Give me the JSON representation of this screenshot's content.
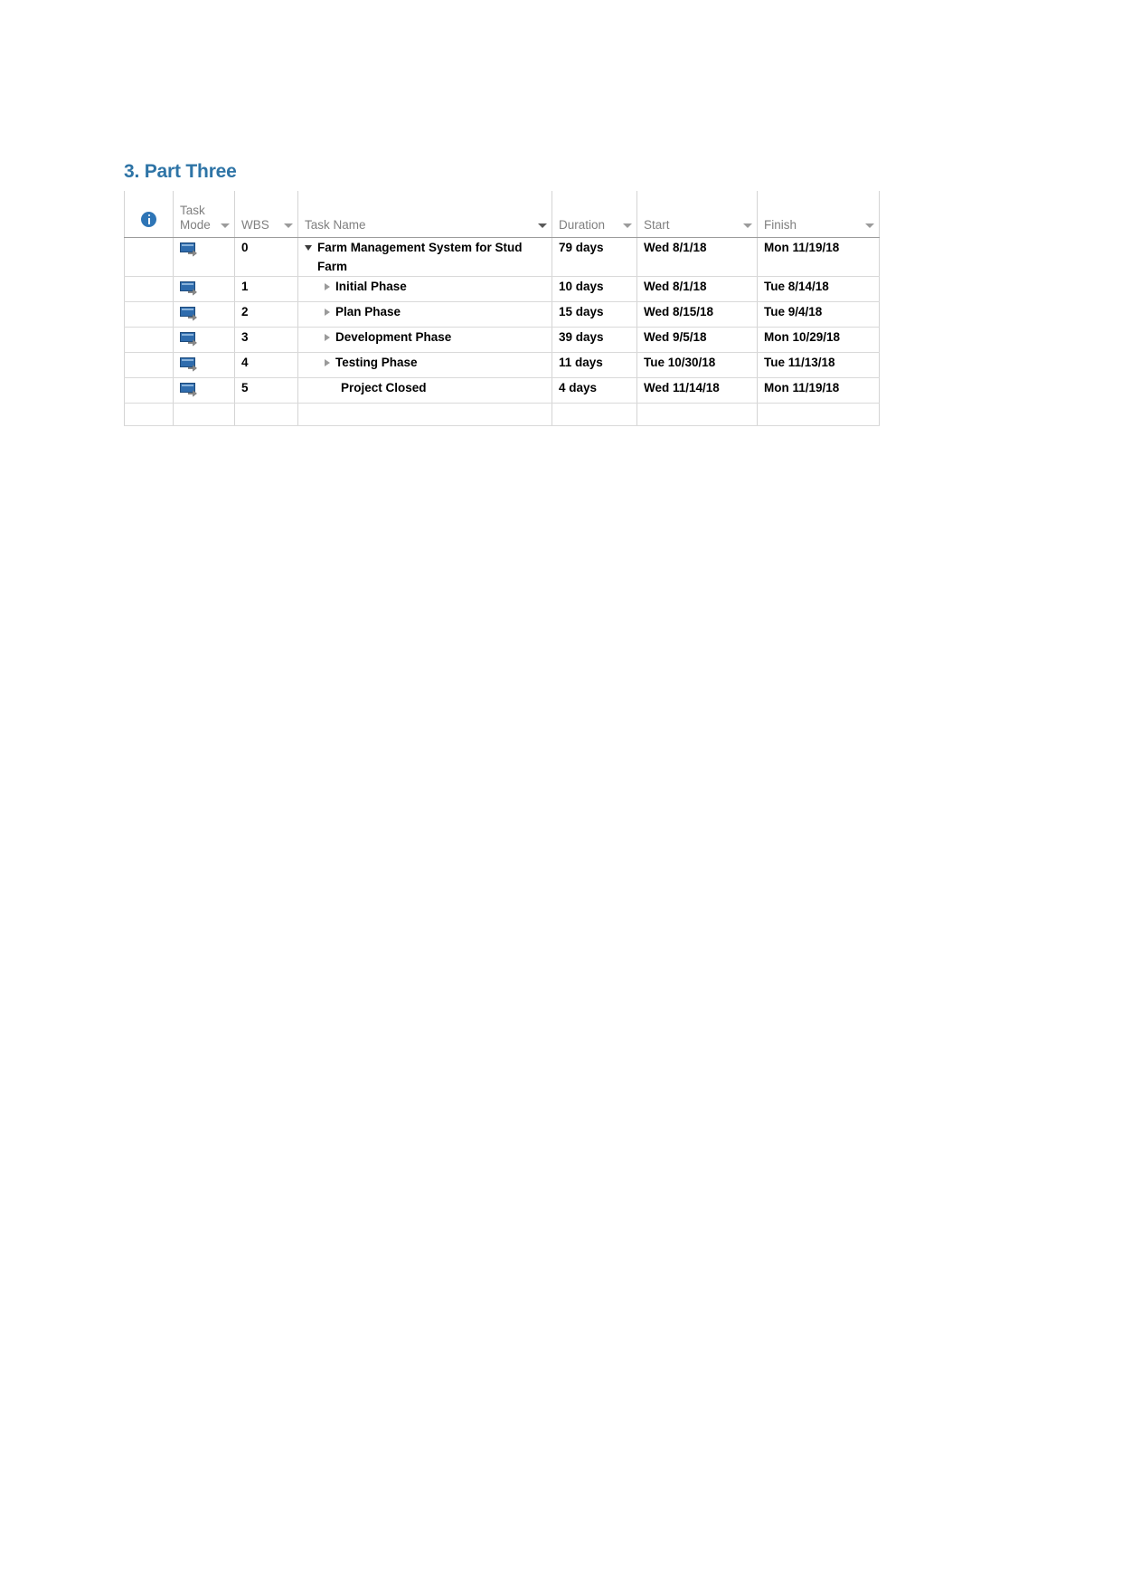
{
  "page": {
    "heading": "3. Part Three"
  },
  "table": {
    "headers": {
      "info": "information-column",
      "task_mode": "Task\nMode",
      "wbs": "WBS",
      "task_name": "Task Name",
      "duration": "Duration",
      "start": "Start",
      "finish": "Finish"
    },
    "selected_column": "Task Name",
    "accent_colors": {
      "heading_blue": "#2E74A6",
      "selected_header_text": "#507E32",
      "selected_header_underline": "#4A7C2F",
      "selected_header_fill": "#DEDEDE",
      "task_mode_icon_blue": "#2F6CAD",
      "info_icon_blue": "#2E75B6",
      "header_text_gray": "#7F7F7F"
    },
    "rows": [
      {
        "mode_icon": "auto-scheduled-icon",
        "wbs": "0",
        "expander": "expanded",
        "indent": 0,
        "bold": true,
        "name": "Farm Management System for Stud Farm",
        "duration": "79 days",
        "start": "Wed 8/1/18",
        "finish": "Mon 11/19/18"
      },
      {
        "mode_icon": "auto-scheduled-icon",
        "wbs": "1",
        "expander": "collapsed",
        "indent": 1,
        "bold": true,
        "name": "Initial Phase",
        "duration": "10 days",
        "start": "Wed 8/1/18",
        "finish": "Tue 8/14/18"
      },
      {
        "mode_icon": "auto-scheduled-icon",
        "wbs": "2",
        "expander": "collapsed",
        "indent": 1,
        "bold": true,
        "name": "Plan Phase",
        "duration": "15 days",
        "start": "Wed 8/15/18",
        "finish": "Tue 9/4/18"
      },
      {
        "mode_icon": "auto-scheduled-icon",
        "wbs": "3",
        "expander": "collapsed",
        "indent": 1,
        "bold": true,
        "name": "Development Phase",
        "duration": "39 days",
        "start": "Wed 9/5/18",
        "finish": "Mon 10/29/18"
      },
      {
        "mode_icon": "auto-scheduled-icon",
        "wbs": "4",
        "expander": "collapsed",
        "indent": 1,
        "bold": true,
        "name": "Testing Phase",
        "duration": "11 days",
        "start": "Tue 10/30/18",
        "finish": "Tue 11/13/18"
      },
      {
        "mode_icon": "auto-scheduled-icon",
        "wbs": "5",
        "expander": "none",
        "indent": 1,
        "bold": false,
        "name": "Project Closed",
        "duration": "4 days",
        "start": "Wed 11/14/18",
        "finish": "Mon 11/19/18"
      }
    ]
  }
}
